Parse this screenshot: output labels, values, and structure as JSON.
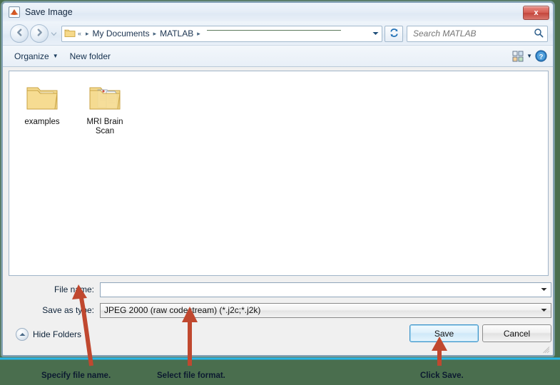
{
  "window": {
    "title": "Save Image",
    "app_icon": "matlab-icon",
    "close_label": "x"
  },
  "nav": {
    "back_icon": "back-arrow-icon",
    "forward_icon": "forward-arrow-icon",
    "history_icon": "chevron-down-icon",
    "folder_icon": "folder-icon",
    "breadcrumbs": [
      "My Documents",
      "MATLAB"
    ],
    "overflow_label": "«",
    "separator": "▸",
    "dropdown_icon": "chevron-down-icon",
    "refresh_icon": "refresh-icon"
  },
  "search": {
    "placeholder": "Search MATLAB",
    "value": "",
    "icon": "search-icon"
  },
  "toolbar": {
    "organize_label": "Organize",
    "organize_caret": "▼",
    "new_folder_label": "New folder",
    "view_icon": "view-mode-icon",
    "view_caret": "▼",
    "help_icon": "help-icon",
    "help_label": "?"
  },
  "files": [
    {
      "name": "examples",
      "icon": "folder-icon",
      "type": "folder"
    },
    {
      "name": "MRI Brain Scan",
      "icon": "folder-documents-icon",
      "type": "folder"
    }
  ],
  "form": {
    "filename_label": "File name:",
    "filename_value": "",
    "filename_placeholder": "",
    "filetype_label": "Save as type:",
    "filetype_value": "JPEG 2000 (raw codestream) (*.j2c;*.j2k)",
    "dropdown_icon": "chevron-down-icon"
  },
  "footer": {
    "hide_folders_label": "Hide Folders",
    "hide_folders_icon": "chevron-up-icon",
    "save_label": "Save",
    "cancel_label": "Cancel",
    "resize_grip_icon": "resize-grip-icon"
  },
  "annotations": {
    "accent_color": "#c0482f",
    "rule_color": "#29b6e8",
    "text_color": "#0c1a30",
    "items": [
      {
        "text": "Specify file name.",
        "arrow": "arrow-to-filename"
      },
      {
        "text": "Select file format.",
        "arrow": "arrow-to-filetype"
      },
      {
        "text": "Click Save.",
        "arrow": "arrow-to-save"
      }
    ]
  },
  "colors": {
    "desktop_background": "#4a6e4e",
    "dialog_background": "#f0f0f0",
    "close_button": "#c9493e",
    "save_button_border": "#3c93c9"
  }
}
